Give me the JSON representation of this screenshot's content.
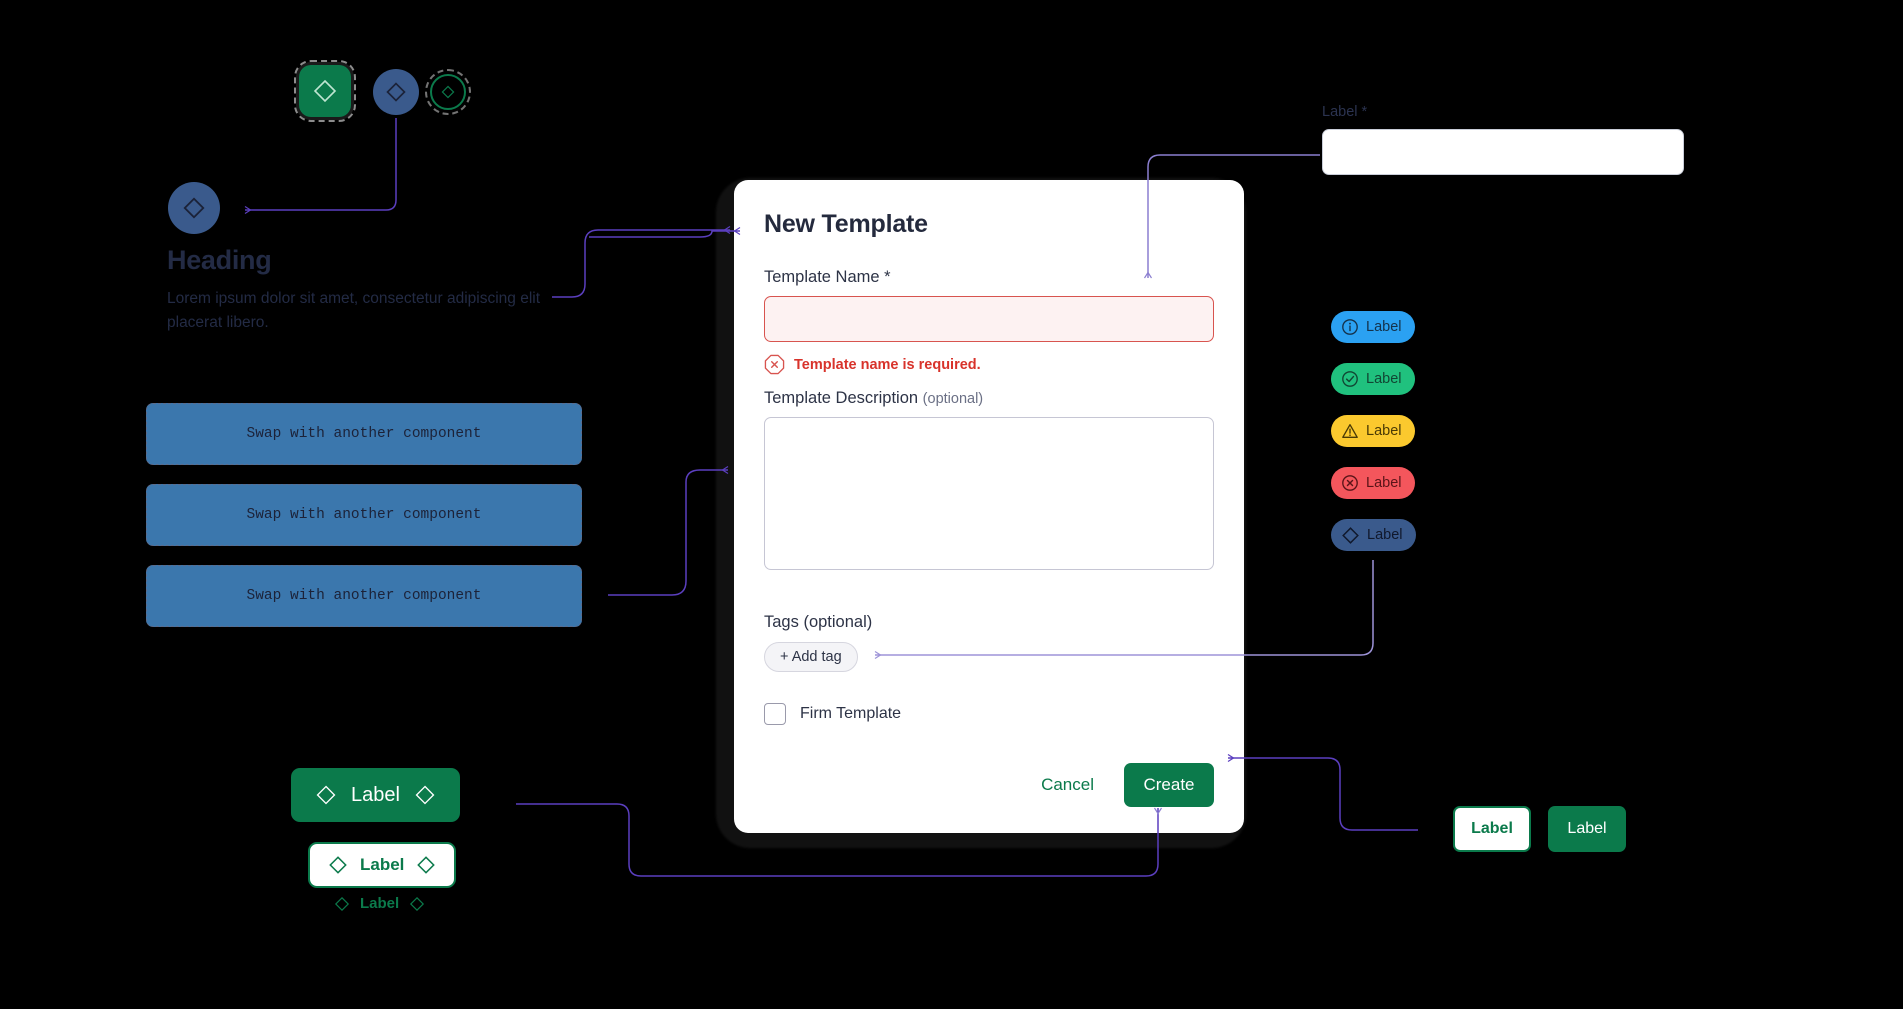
{
  "palette": {
    "background": "#000000",
    "brand_green": "#0B7A4B",
    "navy": "#232B45",
    "placeholder_blue": "#3B77AD",
    "chip_blue": "#3A5A8C",
    "connector_dark": "#5B3FBF",
    "connector_light": "#9D93D8",
    "error_red": "#D8332B",
    "error_border": "#D8544F",
    "error_fill": "#FDF2F2"
  },
  "modal": {
    "title": "New Template",
    "name_field": {
      "label": "Template Name",
      "required_mark": "*",
      "value": "",
      "placeholder": "",
      "error_icon": "error-octagon-icon",
      "error_message": "Template name is required."
    },
    "description_field": {
      "label": "Template Description",
      "optional_mark": "(optional)",
      "value": "",
      "placeholder": ""
    },
    "tags_field": {
      "label": "Tags",
      "optional_mark": "(optional)",
      "add_tag_label": "+ Add tag"
    },
    "firm_template": {
      "label": "Firm Template",
      "checked": false
    },
    "actions": {
      "cancel_label": "Cancel",
      "create_label": "Create"
    }
  },
  "icon_chips": [
    {
      "name": "diamond-icon-square-green",
      "icon": "diamond-icon",
      "shape": "rounded-square",
      "fill": "#0B7A4B",
      "stroke": "#BFE6D2"
    },
    {
      "name": "diamond-icon-circle-blue",
      "icon": "diamond-icon",
      "shape": "circle",
      "fill": "#3A5A8C",
      "stroke": "#1B2238"
    },
    {
      "name": "diamond-icon-circle-outline-green",
      "icon": "diamond-icon",
      "shape": "circle-outline",
      "fill": "none",
      "stroke": "#0B7A4B"
    }
  ],
  "avatar_chip": {
    "name": "diamond-icon-avatar",
    "icon": "diamond-icon",
    "fill": "#3A5A8C",
    "stroke": "#1B2238"
  },
  "heading_block": {
    "title": "Heading",
    "body": "Lorem ipsum dolor sit amet, consectetur adipiscing elit placerat libero."
  },
  "swap_blocks": [
    {
      "label": "Swap with another component"
    },
    {
      "label": "Swap with another component"
    },
    {
      "label": "Swap with another component"
    }
  ],
  "green_buttons": [
    {
      "name": "button-filled",
      "label": "Label",
      "variant": "filled",
      "leading_icon": "diamond-icon",
      "trailing_icon": "diamond-icon"
    },
    {
      "name": "button-outline",
      "label": "Label",
      "variant": "outline",
      "leading_icon": "diamond-icon",
      "trailing_icon": "diamond-icon"
    },
    {
      "name": "button-text",
      "label": "Label",
      "variant": "text",
      "leading_icon": "diamond-icon",
      "trailing_icon": "diamond-icon"
    }
  ],
  "small_buttons": [
    {
      "name": "button-small-outline",
      "label": "Label",
      "variant": "outline"
    },
    {
      "name": "button-small-filled",
      "label": "Label",
      "variant": "filled"
    }
  ],
  "badges": [
    {
      "name": "badge-info",
      "label": "Label",
      "icon": "info-circle-icon",
      "bg": "#2BA1F2",
      "fg": "#14324B"
    },
    {
      "name": "badge-success",
      "label": "Label",
      "icon": "check-circle-icon",
      "bg": "#20C17E",
      "fg": "#114633"
    },
    {
      "name": "badge-warning",
      "label": "Label",
      "icon": "warning-triangle-icon",
      "bg": "#FBC92E",
      "fg": "#4A3A05"
    },
    {
      "name": "badge-error",
      "label": "Label",
      "icon": "error-circle-icon",
      "bg": "#F4565C",
      "fg": "#5A1418"
    },
    {
      "name": "badge-neutral",
      "label": "Label",
      "icon": "diamond-icon",
      "bg": "#3A5A8C",
      "fg": "#10182C"
    }
  ],
  "top_right_field": {
    "label": "Label",
    "required_mark": "*",
    "value": "",
    "placeholder": ""
  }
}
